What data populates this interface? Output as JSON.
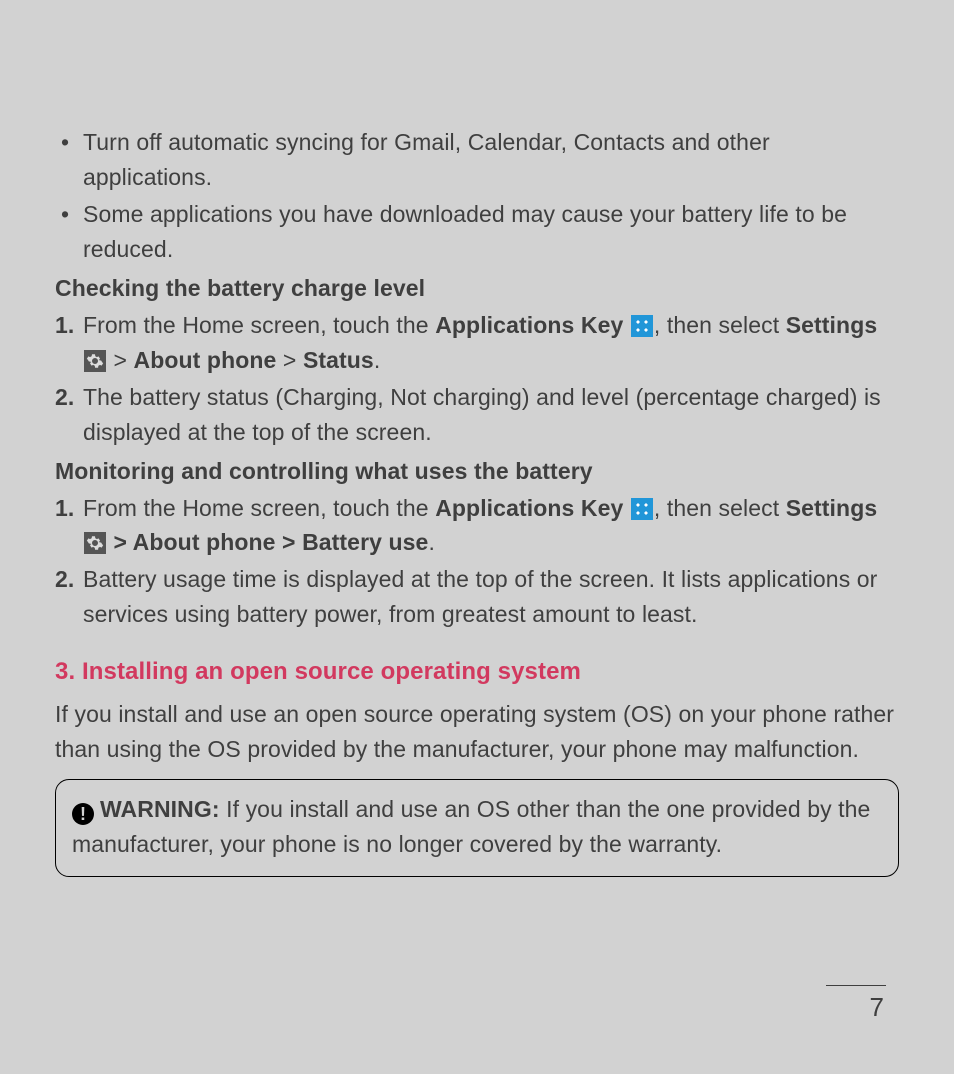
{
  "bullets": [
    "Turn off automatic syncing for Gmail, Calendar, Contacts and other applications.",
    "Some applications you have downloaded may cause your battery life to be reduced."
  ],
  "sub1": {
    "heading": "Checking the battery charge level",
    "step1_a": "From the Home screen, touch the ",
    "step1_b": "Applications Key",
    "step1_c": ", then select ",
    "step1_d": "Settings",
    "step1_e": " > ",
    "step1_f": "About phone",
    "step1_g": " > ",
    "step1_h": "Status",
    "step1_i": ".",
    "step2": "The battery status (Charging, Not charging) and level (percentage charged) is displayed at the top of the screen."
  },
  "sub2": {
    "heading": "Monitoring and controlling what uses the battery",
    "step1_a": "From the Home screen, touch the ",
    "step1_b": "Applications Key",
    "step1_c": ", then select ",
    "step1_d": "Settings",
    "step1_e": " > About phone > Battery use",
    "step1_f": ".",
    "step2": "Battery usage time is displayed at the top of the screen. It lists applications or services using battery power, from greatest amount to least."
  },
  "section3": {
    "heading": "3. Installing an open source operating system",
    "para": "If you install and use an open source operating system (OS) on your phone rather than using the OS provided by the manufacturer, your phone may malfunction."
  },
  "warning": {
    "label": "WARNING:",
    "text": " If you install and use an OS other than the one provided by the manufacturer, your phone is no longer covered by the warranty."
  },
  "page_number": "7",
  "nums": {
    "one": "1.",
    "two": "2."
  },
  "bullet_glyph": "•"
}
